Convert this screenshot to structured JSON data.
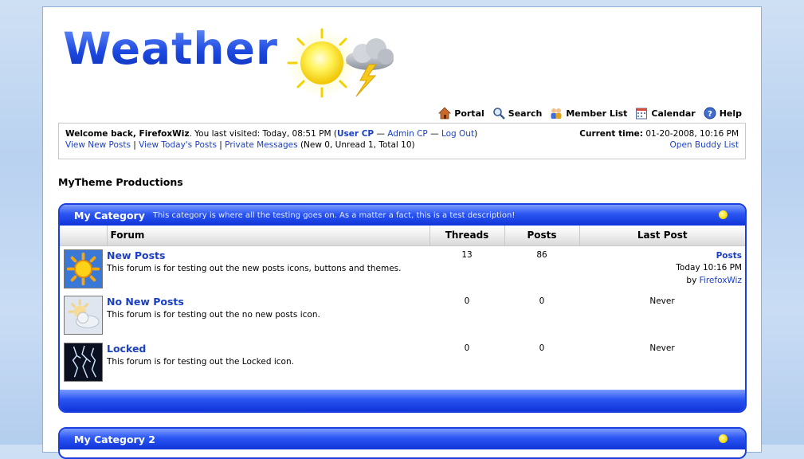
{
  "header": {
    "logo_text": "Weather"
  },
  "topnav": [
    {
      "label": "Portal",
      "icon": "home-icon"
    },
    {
      "label": "Search",
      "icon": "search-icon"
    },
    {
      "label": "Member List",
      "icon": "members-icon"
    },
    {
      "label": "Calendar",
      "icon": "calendar-icon"
    },
    {
      "label": "Help",
      "icon": "help-icon"
    }
  ],
  "welcome": {
    "greeting": "Welcome back, FirefoxWiz",
    "last_visited": ". You last visited: Today, 08:51 PM (",
    "user_cp": "User CP",
    "sep1": " — ",
    "admin_cp": "Admin CP",
    "sep2": " — ",
    "logout": "Log Out",
    "close_paren": ")",
    "current_time_label": "Current time:",
    "current_time_value": "01-20-2008, 10:16 PM",
    "view_new_posts": "View New Posts",
    "view_todays_posts": "View Today's Posts",
    "private_messages": "Private Messages",
    "pm_counts": "(New 0, Unread 1, Total 10)",
    "buddy_list": "Open Buddy List",
    "pipe": "|"
  },
  "productions": "MyTheme Productions",
  "category1": {
    "title": "My Category",
    "description": "This category is where all the testing goes on. As a matter a fact, this is a test description!",
    "columns": {
      "forum": "Forum",
      "threads": "Threads",
      "posts": "Posts",
      "last_post": "Last Post"
    },
    "forums": [
      {
        "name": "New Posts",
        "description": "This forum is for testing out the new posts icons, buttons and themes.",
        "threads": "13",
        "posts": "86",
        "last_post_title": "Posts",
        "last_post_time": "Today 10:16 PM",
        "last_post_by": "by",
        "last_post_user": "FirefoxWiz",
        "icon": "sunny-icon"
      },
      {
        "name": "No New Posts",
        "description": "This forum is for testing out the no new posts icon.",
        "threads": "0",
        "posts": "0",
        "last_post_never": "Never",
        "icon": "partly-cloudy-icon"
      },
      {
        "name": "Locked",
        "description": "This forum is for testing out the Locked icon.",
        "threads": "0",
        "posts": "0",
        "last_post_never": "Never",
        "icon": "lightning-icon"
      }
    ]
  },
  "category2": {
    "title": "My Category 2"
  },
  "colors": {
    "accent": "#1a3ee0",
    "link": "#1b3fc4"
  }
}
